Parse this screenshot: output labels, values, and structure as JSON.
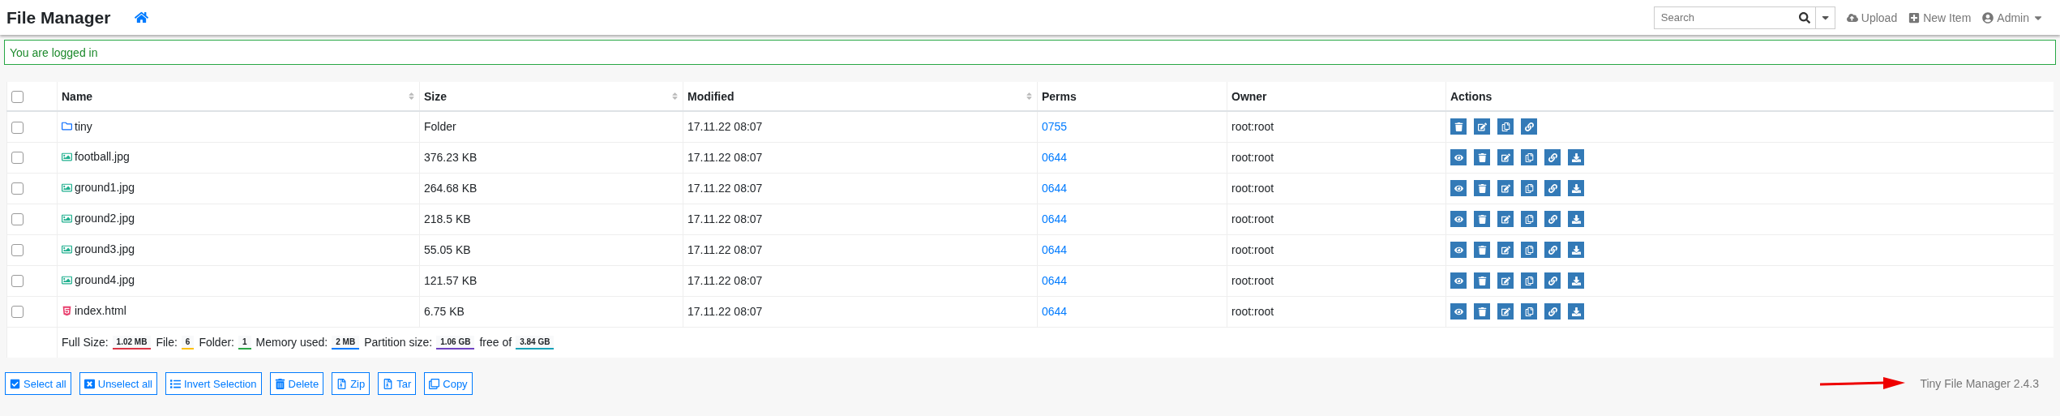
{
  "navbar": {
    "title": "File Manager",
    "search": {
      "placeholder": "Search"
    },
    "links": [
      {
        "kind": "upload",
        "label": "Upload"
      },
      {
        "kind": "new",
        "label": "New Item"
      },
      {
        "kind": "user",
        "label": "Admin"
      }
    ]
  },
  "alert": "You are logged in",
  "table": {
    "header_checked": false,
    "columns": [
      {
        "label": "Name",
        "sortable": true
      },
      {
        "label": "Size",
        "sortable": true
      },
      {
        "label": "Modified",
        "sortable": true
      },
      {
        "label": "Perms",
        "sortable": false
      },
      {
        "label": "Owner",
        "sortable": false
      },
      {
        "label": "Actions",
        "sortable": false
      }
    ],
    "rows": [
      {
        "checked": false,
        "kind": "folder",
        "name": "tiny",
        "size": "Folder",
        "modified": "17.11.22 08:07",
        "perms": "0755",
        "owner": "root:root",
        "actions": [
          {
            "kind": "delete"
          },
          {
            "kind": "rename"
          },
          {
            "kind": "copy"
          },
          {
            "kind": "link"
          }
        ]
      },
      {
        "checked": false,
        "kind": "image",
        "name": "football.jpg",
        "size": "376.23 KB",
        "modified": "17.11.22 08:07",
        "perms": "0644",
        "owner": "root:root",
        "actions": [
          {
            "kind": "view"
          },
          {
            "kind": "delete"
          },
          {
            "kind": "rename"
          },
          {
            "kind": "copy"
          },
          {
            "kind": "link"
          },
          {
            "kind": "download"
          }
        ]
      },
      {
        "checked": false,
        "kind": "image",
        "name": "ground1.jpg",
        "size": "264.68 KB",
        "modified": "17.11.22 08:07",
        "perms": "0644",
        "owner": "root:root",
        "actions": [
          {
            "kind": "view"
          },
          {
            "kind": "delete"
          },
          {
            "kind": "rename"
          },
          {
            "kind": "copy"
          },
          {
            "kind": "link"
          },
          {
            "kind": "download"
          }
        ]
      },
      {
        "checked": false,
        "kind": "image",
        "name": "ground2.jpg",
        "size": "218.5 KB",
        "modified": "17.11.22 08:07",
        "perms": "0644",
        "owner": "root:root",
        "actions": [
          {
            "kind": "view"
          },
          {
            "kind": "delete"
          },
          {
            "kind": "rename"
          },
          {
            "kind": "copy"
          },
          {
            "kind": "link"
          },
          {
            "kind": "download"
          }
        ]
      },
      {
        "checked": false,
        "kind": "image",
        "name": "ground3.jpg",
        "size": "55.05 KB",
        "modified": "17.11.22 08:07",
        "perms": "0644",
        "owner": "root:root",
        "actions": [
          {
            "kind": "view"
          },
          {
            "kind": "delete"
          },
          {
            "kind": "rename"
          },
          {
            "kind": "copy"
          },
          {
            "kind": "link"
          },
          {
            "kind": "download"
          }
        ]
      },
      {
        "checked": false,
        "kind": "image",
        "name": "ground4.jpg",
        "size": "121.57 KB",
        "modified": "17.11.22 08:07",
        "perms": "0644",
        "owner": "root:root",
        "actions": [
          {
            "kind": "view"
          },
          {
            "kind": "delete"
          },
          {
            "kind": "rename"
          },
          {
            "kind": "copy"
          },
          {
            "kind": "link"
          },
          {
            "kind": "download"
          }
        ]
      },
      {
        "checked": false,
        "kind": "html",
        "name": "index.html",
        "size": "6.75 KB",
        "modified": "17.11.22 08:07",
        "perms": "0644",
        "owner": "root:root",
        "actions": [
          {
            "kind": "view"
          },
          {
            "kind": "delete"
          },
          {
            "kind": "rename"
          },
          {
            "kind": "copy"
          },
          {
            "kind": "link"
          },
          {
            "kind": "download"
          }
        ]
      }
    ],
    "summary": [
      {
        "label": "Full Size:",
        "value": "1.02 MB",
        "color": "#dc3545"
      },
      {
        "label": "File:",
        "value": "6",
        "color": "#ffc107"
      },
      {
        "label": "Folder:",
        "value": "1",
        "color": "#28a745"
      },
      {
        "label": "Memory used:",
        "value": "2 MB",
        "color": "#007bff"
      },
      {
        "label": "Partition size:",
        "value": "1.06 GB",
        "color": "#6f42c1"
      },
      {
        "label": "free of",
        "value": "3.84 GB",
        "color": "#17a2b8"
      }
    ]
  },
  "buttons": [
    {
      "kind": "select",
      "label": "Select all"
    },
    {
      "kind": "unselect",
      "label": "Unselect all"
    },
    {
      "kind": "invert",
      "label": "Invert Selection"
    },
    {
      "kind": "delete",
      "label": "Delete"
    },
    {
      "kind": "zip",
      "label": "Zip"
    },
    {
      "kind": "tar",
      "label": "Tar"
    },
    {
      "kind": "copy",
      "label": "Copy"
    }
  ],
  "footer": "Tiny File Manager 2.4.3"
}
